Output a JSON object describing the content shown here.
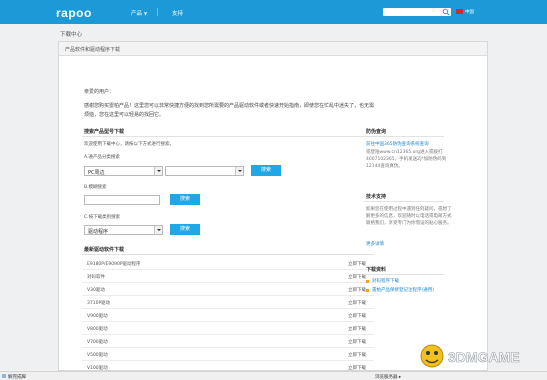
{
  "header": {
    "logo": "rapoo",
    "nav": [
      {
        "label": "产品"
      },
      {
        "label": "支持"
      }
    ],
    "lang": "中国"
  },
  "breadcrumb": "下载中心",
  "panel_title": "产品软件和驱动程序下载",
  "greeting": "亲爱的用户：",
  "intro": "感谢您购买雷柏产品！这里您可以非常快捷方便的找到您所需要的产品驱动软件或者快速开始指南，即使您在忙乱中迷失了，也无需烦恼，您在这里可以轻易的找回它。",
  "search": {
    "title": "搜索产品型号下载",
    "hint": "欢迎使用下载中心，请按以下方式进行搜索。",
    "a_label": "A.通产品分类搜索",
    "a_select1": "PC周边",
    "a_select2": "",
    "a_button": "搜索",
    "b_label": "B.模糊搜索",
    "b_button": "搜索",
    "c_label": "C.按下载类别搜索",
    "c_select": "驱动程序",
    "c_button": "搜索"
  },
  "latest": {
    "title": "最新驱动软件下载",
    "rows": [
      {
        "name": "E9180P/E9090P驱动程序",
        "link": "立即下载"
      },
      {
        "name": "对码软件",
        "link": "立即下载"
      },
      {
        "name": "V30驱动",
        "link": "立即下载"
      },
      {
        "name": "3710P驱动",
        "link": "立即下载"
      },
      {
        "name": "V900驱动",
        "link": "立即下载"
      },
      {
        "name": "V800驱动",
        "link": "立即下载"
      },
      {
        "name": "V700驱动",
        "link": "立即下载"
      },
      {
        "name": "V500驱动",
        "link": "立即下载"
      },
      {
        "name": "V100驱动",
        "link": "立即下载"
      }
    ]
  },
  "sidebar": {
    "anti_fake": {
      "title": "防伪查询",
      "link": "前往中国365防伪查询系统查询",
      "text": "或登陆www.cn12365.org进入或拨打4007102365，手机发送ZJ*加防伪码到12144查询真伪。"
    },
    "support": {
      "title": "技术支持",
      "text": "如果您在使用过程中遇到任何疑问，或想了解更多的信息，欢迎随时以电话或电邮方式联络我们，享受专门为你而设的贴心服务。",
      "link": "更多详情"
    },
    "downloads": {
      "title": "下载资料",
      "items": [
        {
          "label": "对码程序下载"
        },
        {
          "label": "雷柏产品保修登记注程序(通用)"
        }
      ]
    }
  },
  "statusbar": {
    "left": "解完成脚",
    "right": "浏览服务器 ▸"
  },
  "watermark": "3DMGAME",
  "colors": {
    "brand": "#1c9ad7",
    "button": "#20a7e5",
    "link": "#1f86c9",
    "bullet": "#f2a51c"
  }
}
